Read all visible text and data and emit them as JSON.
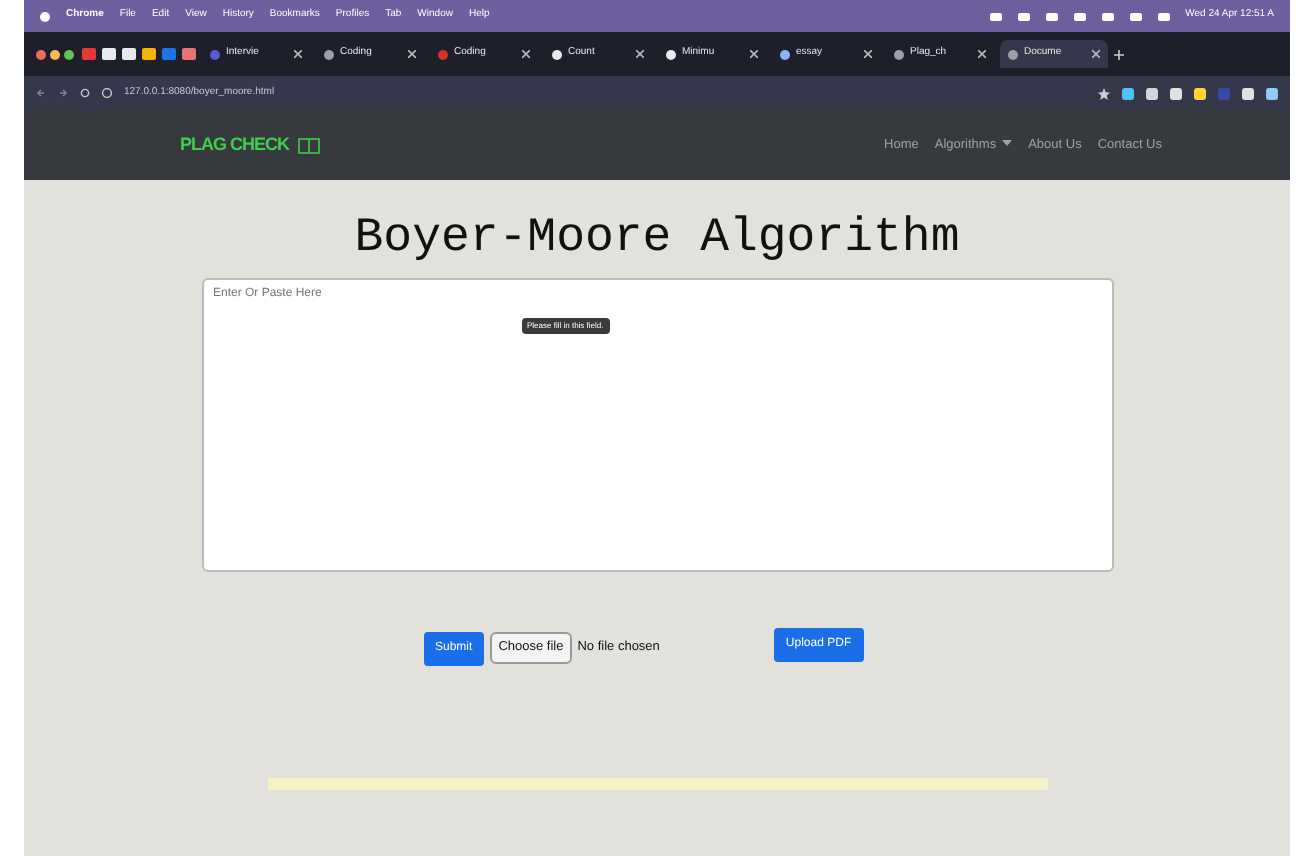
{
  "menu_bar": {
    "app": "Chrome",
    "items": [
      "File",
      "Edit",
      "View",
      "History",
      "Bookmarks",
      "Profiles",
      "Tab",
      "Window",
      "Help"
    ],
    "clock": "Wed 24 Apr 12:51 A"
  },
  "tabs": [
    {
      "label": "Intervie",
      "color": "#5b5bd6",
      "selected": false
    },
    {
      "label": "Coding",
      "color": "#9aa0a6",
      "selected": false
    },
    {
      "label": "Coding",
      "color": "#d93025",
      "selected": false
    },
    {
      "label": "Count",
      "color": "#e8eaed",
      "selected": false
    },
    {
      "label": "Minimu",
      "color": "#e8eaed",
      "selected": false
    },
    {
      "label": "essay",
      "color": "#8ab4f8",
      "selected": false
    },
    {
      "label": "Plag_ch",
      "color": "#9aa0a6",
      "selected": false
    },
    {
      "label": "Docume",
      "color": "#9aa0a6",
      "selected": true
    }
  ],
  "address_bar": {
    "url": "127.0.0.1:8080/boyer_moore.html"
  },
  "navbar": {
    "brand": "PLAG CHECK",
    "links": [
      {
        "label": "Home",
        "kind": "link"
      },
      {
        "label": "Algorithms",
        "kind": "dropdown"
      },
      {
        "label": "About Us",
        "kind": "link"
      },
      {
        "label": "Contact Us",
        "kind": "link"
      }
    ]
  },
  "page": {
    "title": "Boyer-Moore Algorithm",
    "textarea": {
      "placeholder": "Enter Or Paste Here"
    },
    "tooltip": "Please fill in this field.",
    "submit": "Submit",
    "file_button": "Choose file",
    "file_status": "No file chosen",
    "upload": "Upload PDF"
  }
}
